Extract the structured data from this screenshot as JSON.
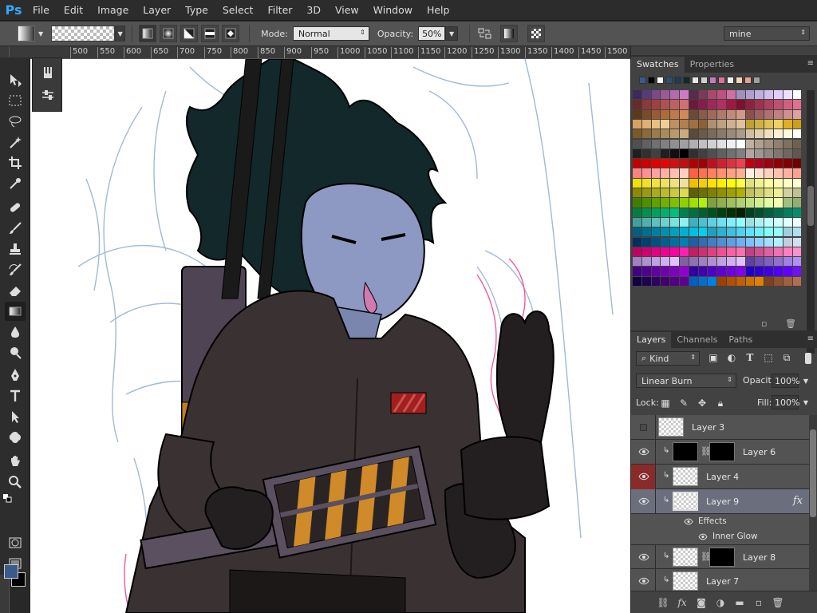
{
  "app": {
    "logo": "Ps"
  },
  "menu": [
    "File",
    "Edit",
    "Image",
    "Layer",
    "Type",
    "Select",
    "Filter",
    "3D",
    "View",
    "Window",
    "Help"
  ],
  "options": {
    "mode_label": "Mode:",
    "mode_value": "Normal",
    "opacity_label": "Opacity:",
    "opacity_value": "50%",
    "preset_value": "mine"
  },
  "ruler": [
    "500",
    "550",
    "600",
    "650",
    "700",
    "750",
    "800",
    "850",
    "900",
    "950",
    "1000",
    "1050",
    "1100",
    "1150",
    "1200",
    "1250",
    "1300",
    "1350",
    "1400",
    "1450",
    "1500"
  ],
  "swatches_panel": {
    "tabs": [
      "Swatches",
      "Properties"
    ],
    "recent_colors": [
      "#3b5a8c",
      "#000000",
      "#ffffff",
      "#2f4f6f",
      "#1d3a5a",
      "#0d2b2b",
      "#e8e8e8",
      "#d0d0d0",
      "#c67cc0",
      "#e36f9f",
      "#f0f0f0",
      "#f5d5b5",
      "#e9a090",
      "#a0a0a0"
    ],
    "rows": [
      [
        "#3b2a5e",
        "#5a3a7a",
        "#7a4a8a",
        "#9a5a9a",
        "#b46ab0",
        "#cf7ac4",
        "#5a2a4a",
        "#7a3a5a",
        "#aa4a6a",
        "#c05080",
        "#d070a0",
        "#a090c0",
        "#b0a0d0",
        "#c0b0e0",
        "#d0c0f0",
        "#e0d0ff",
        "#f0e0ff",
        "#ffffff"
      ],
      [
        "#6a2a2a",
        "#8a3a3a",
        "#a04040",
        "#b05050",
        "#c06060",
        "#d07070",
        "#6a1a3a",
        "#8a1a4a",
        "#9a2a5a",
        "#b03060",
        "#a01840",
        "#801030",
        "#902040",
        "#a03050",
        "#b04060",
        "#c05070",
        "#d06080",
        "#e07090"
      ],
      [
        "#5a3a1a",
        "#7a4a2a",
        "#9a5a3a",
        "#b06a3a",
        "#c07a4a",
        "#d08a5a",
        "#6a4a3a",
        "#8a5a4a",
        "#a06a5a",
        "#b07a6a",
        "#c08a7a",
        "#d09a8a",
        "#8a5050",
        "#a06060",
        "#b07070",
        "#c08080",
        "#d09090",
        "#e0a0a0"
      ],
      [
        "#d8a060",
        "#e0b070",
        "#e8c080",
        "#f0d090",
        "#c09060",
        "#b08050",
        "#a07040",
        "#906030",
        "#b09070",
        "#c0a080",
        "#d0b090",
        "#e0c0a0",
        "#c0a030",
        "#d0b040",
        "#e0c050",
        "#f0d060",
        "#e0b020",
        "#d0a010"
      ],
      [
        "#7a5a2a",
        "#8a6a3a",
        "#9a7a4a",
        "#aa8a5a",
        "#ba9a6a",
        "#caaa7a",
        "#5a4a3a",
        "#6a5a4a",
        "#7a6a5a",
        "#8a7a6a",
        "#9a8a7a",
        "#aa9a8a",
        "#d0c0a0",
        "#e0d0b0",
        "#f0e0c0",
        "#fff0d0",
        "#fff8e0",
        "#ffffff"
      ],
      [
        "#505050",
        "#606060",
        "#707070",
        "#808080",
        "#909090",
        "#a0a0a0",
        "#b0b0b0",
        "#c0c0c0",
        "#d0d0d0",
        "#e0e0e0",
        "#f0f0f0",
        "#ffffff",
        "#c0b0a0",
        "#b0a090",
        "#a09080",
        "#908070",
        "#807060",
        "#706050"
      ],
      [
        "#202020",
        "#303030",
        "#404040",
        "#202020",
        "#101010",
        "#000000",
        "#303030",
        "#404040",
        "#505050",
        "#606060",
        "#707070",
        "#808080",
        "#b0a8a0",
        "#a09890",
        "#908880",
        "#807870",
        "#706860",
        "#605850"
      ],
      [
        "#c00000",
        "#d00000",
        "#e00000",
        "#f00000",
        "#d01010",
        "#c01010",
        "#b00000",
        "#a00000",
        "#c01020",
        "#d02030",
        "#e03040",
        "#f04050",
        "#c00010",
        "#b00020",
        "#a00010",
        "#900000",
        "#800000",
        "#700000"
      ],
      [
        "#ff8080",
        "#ff9090",
        "#ffa0a0",
        "#ffb0a0",
        "#ffc0b0",
        "#ffd0c0",
        "#ff6040",
        "#ff7050",
        "#ff8060",
        "#ff9070",
        "#ffa080",
        "#ffb090",
        "#fff0e0",
        "#ffe0d0",
        "#ffd0c0",
        "#ffc0b0",
        "#ffb0a0",
        "#ffa090"
      ],
      [
        "#f0e000",
        "#f0e020",
        "#f0e040",
        "#f0e060",
        "#f0e080",
        "#f0e0a0",
        "#f0c000",
        "#f0d000",
        "#ffe000",
        "#fff000",
        "#ffff00",
        "#ffff40",
        "#e0e080",
        "#f0f090",
        "#ffffa0",
        "#ffffb0",
        "#ffffc0",
        "#ffffd0"
      ],
      [
        "#8a8a00",
        "#9a9a10",
        "#aaaa20",
        "#baba30",
        "#caca40",
        "#dada50",
        "#606000",
        "#707000",
        "#808000",
        "#909000",
        "#a0a000",
        "#b0b000",
        "#c0c060",
        "#d0d070",
        "#e0e080",
        "#f0f090",
        "#d0d0a0",
        "#c0c090"
      ],
      [
        "#408000",
        "#509000",
        "#60a000",
        "#70b000",
        "#80c000",
        "#90d000",
        "#a0e000",
        "#b0f000",
        "#80a040",
        "#90b050",
        "#a0c060",
        "#b0d070",
        "#c0e080",
        "#d0f090",
        "#e0ffa0",
        "#f0ffb0",
        "#a0c080",
        "#90b070"
      ],
      [
        "#008040",
        "#009050",
        "#00a060",
        "#00b070",
        "#00c080",
        "#008050",
        "#007040",
        "#006030",
        "#005020",
        "#004010",
        "#003000",
        "#002000",
        "#004020",
        "#005030",
        "#006040",
        "#007050",
        "#008060",
        "#009070"
      ],
      [
        "#40a0a0",
        "#50b0b0",
        "#60c0c0",
        "#70d0d0",
        "#80e0e0",
        "#90f0f0",
        "#40b0c0",
        "#50c0d0",
        "#60d0e0",
        "#70e0f0",
        "#80f0ff",
        "#90ffff",
        "#a0e0e0",
        "#b0f0f0",
        "#c0ffff",
        "#d0ffff",
        "#e0ffff",
        "#f0ffff"
      ],
      [
        "#006080",
        "#007090",
        "#0080a0",
        "#0090b0",
        "#00a0c0",
        "#00b0d0",
        "#00c0e0",
        "#00d0f0",
        "#20a0c0",
        "#30b0d0",
        "#40c0e0",
        "#50d0f0",
        "#60e0ff",
        "#70f0ff",
        "#80ffff",
        "#90ffff",
        "#a0d0e0",
        "#b0e0f0"
      ],
      [
        "#003060",
        "#004070",
        "#005080",
        "#006090",
        "#0070a0",
        "#0080b0",
        "#2060a0",
        "#3070b0",
        "#4080c0",
        "#5090d0",
        "#60a0e0",
        "#70b0f0",
        "#80c0ff",
        "#90d0ff",
        "#a0e0ff",
        "#b0f0ff",
        "#c0d0e0",
        "#d0e0f0"
      ],
      [
        "#c00060",
        "#d00070",
        "#e00080",
        "#f00090",
        "#ff00a0",
        "#ff20b0",
        "#c02060",
        "#d03070",
        "#e04080",
        "#f05090",
        "#ff60a0",
        "#ff70b0",
        "#c04080",
        "#d05090",
        "#e060a0",
        "#f070b0",
        "#ff80c0",
        "#ff90d0"
      ],
      [
        "#a080c0",
        "#b090d0",
        "#c0a0e0",
        "#d0b0f0",
        "#e0c0ff",
        "#8060a0",
        "#9070b0",
        "#a080c0",
        "#b090d0",
        "#c0a0e0",
        "#d0b0f0",
        "#e0c0ff",
        "#6040a0",
        "#7050b0",
        "#8060c0",
        "#9070d0",
        "#a080e0",
        "#b090f0"
      ],
      [
        "#400080",
        "#500090",
        "#6000a0",
        "#7000b0",
        "#8000c0",
        "#9000d0",
        "#3000a0",
        "#4000b0",
        "#5000c0",
        "#6000d0",
        "#7000e0",
        "#8000f0",
        "#2000c0",
        "#3000d0",
        "#4000e0",
        "#5000f0",
        "#6000ff",
        "#7010ff"
      ],
      [
        "#100040",
        "#200050",
        "#300060",
        "#400070",
        "#500080",
        "#600090",
        "#0060c0",
        "#0070d0",
        "#0080e0",
        "#a04000",
        "#b05000",
        "#c06000",
        "#d07000",
        "#e08000",
        "#804020",
        "#905030",
        "#a06040",
        "#b07050"
      ]
    ]
  },
  "layers_panel": {
    "tabs": [
      "Layers",
      "Channels",
      "Paths"
    ],
    "filter_value": "Kind",
    "blend_mode": "Linear Burn",
    "opacity_label": "Opacity:",
    "opacity_value": "100%",
    "lock_label": "Lock:",
    "fill_label": "Fill:",
    "fill_value": "100%",
    "layers": [
      {
        "name": "Layer 3"
      },
      {
        "name": "Layer 6"
      },
      {
        "name": "Layer 4"
      },
      {
        "name": "Layer 9"
      },
      {
        "name": "Layer 8"
      },
      {
        "name": "Layer 7"
      }
    ],
    "effects_label": "Effects",
    "effect_name": "Inner Glow",
    "fx_label": "fx"
  },
  "colors": {
    "foreground": "#3b5a8c",
    "background": "#000000"
  }
}
